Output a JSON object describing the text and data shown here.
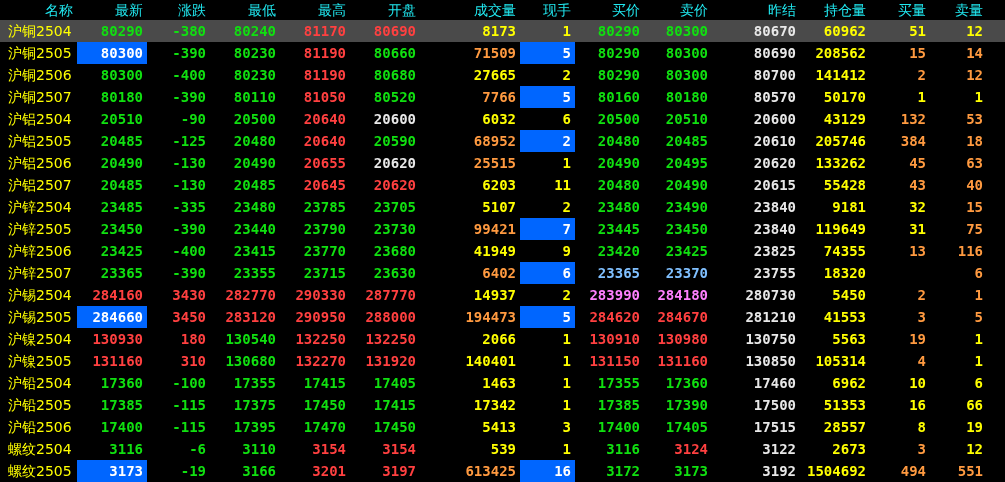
{
  "table": {
    "columns": [
      "名称",
      "最新",
      "涨跌",
      "最低",
      "最高",
      "开盘",
      "成交量",
      "现手",
      "买价",
      "卖价",
      "昨结",
      "持仓量",
      "买量",
      "卖量"
    ],
    "rows": [
      {
        "selected": true,
        "cells": [
          {
            "text": "沪铜2504"
          },
          {
            "text": "80290",
            "color": "#10e010"
          },
          {
            "text": "-380",
            "color": "#10e010"
          },
          {
            "text": "80240",
            "color": "#10e010"
          },
          {
            "text": "81170",
            "color": "#ff4040"
          },
          {
            "text": "80690",
            "color": "#ff4040"
          },
          {
            "text": "8173",
            "color": "#ffff00"
          },
          {
            "text": "1",
            "color": "#ffff00"
          },
          {
            "text": "80290",
            "color": "#10e010"
          },
          {
            "text": "80300",
            "color": "#10e010"
          },
          {
            "text": "80670",
            "color": "#e8e8e8"
          },
          {
            "text": "60962",
            "color": "#ffff00"
          },
          {
            "text": "51",
            "color": "#ffff00"
          },
          {
            "text": "12",
            "color": "#ffff00"
          }
        ]
      },
      {
        "selected": false,
        "cells": [
          {
            "text": "沪铜2505"
          },
          {
            "text": "80300",
            "highlighted": true
          },
          {
            "text": "-390",
            "color": "#10e010"
          },
          {
            "text": "80230",
            "color": "#10e010"
          },
          {
            "text": "81190",
            "color": "#ff4040"
          },
          {
            "text": "80660",
            "color": "#10e010"
          },
          {
            "text": "71509",
            "color": "#ff9a40"
          },
          {
            "text": "5",
            "highlighted": true
          },
          {
            "text": "80290",
            "color": "#10e010"
          },
          {
            "text": "80300",
            "color": "#10e010"
          },
          {
            "text": "80690",
            "color": "#e8e8e8"
          },
          {
            "text": "208562",
            "color": "#ffff00"
          },
          {
            "text": "15",
            "color": "#ff9a40"
          },
          {
            "text": "14",
            "color": "#ff9a40"
          }
        ]
      },
      {
        "selected": false,
        "cells": [
          {
            "text": "沪铜2506"
          },
          {
            "text": "80300",
            "color": "#10e010"
          },
          {
            "text": "-400",
            "color": "#10e010"
          },
          {
            "text": "80230",
            "color": "#10e010"
          },
          {
            "text": "81190",
            "color": "#ff4040"
          },
          {
            "text": "80680",
            "color": "#10e010"
          },
          {
            "text": "27665",
            "color": "#ffff00"
          },
          {
            "text": "2",
            "color": "#ffff00"
          },
          {
            "text": "80290",
            "color": "#10e010"
          },
          {
            "text": "80300",
            "color": "#10e010"
          },
          {
            "text": "80700",
            "color": "#e8e8e8"
          },
          {
            "text": "141412",
            "color": "#ffff00"
          },
          {
            "text": "2",
            "color": "#ff9a40"
          },
          {
            "text": "12",
            "color": "#ff9a40"
          }
        ]
      },
      {
        "selected": false,
        "cells": [
          {
            "text": "沪铜2507"
          },
          {
            "text": "80180",
            "color": "#10e010"
          },
          {
            "text": "-390",
            "color": "#10e010"
          },
          {
            "text": "80110",
            "color": "#10e010"
          },
          {
            "text": "81050",
            "color": "#ff4040"
          },
          {
            "text": "80520",
            "color": "#10e010"
          },
          {
            "text": "7766",
            "color": "#ff9a40"
          },
          {
            "text": "5",
            "highlighted": true
          },
          {
            "text": "80160",
            "color": "#10e010"
          },
          {
            "text": "80180",
            "color": "#10e010"
          },
          {
            "text": "80570",
            "color": "#e8e8e8"
          },
          {
            "text": "50170",
            "color": "#ffff00"
          },
          {
            "text": "1",
            "color": "#ffff00"
          },
          {
            "text": "1",
            "color": "#ffff00"
          }
        ]
      },
      {
        "selected": false,
        "cells": [
          {
            "text": "沪铝2504"
          },
          {
            "text": "20510",
            "color": "#10e010"
          },
          {
            "text": "-90",
            "color": "#10e010"
          },
          {
            "text": "20500",
            "color": "#10e010"
          },
          {
            "text": "20640",
            "color": "#ff4040"
          },
          {
            "text": "20600",
            "color": "#e8e8e8"
          },
          {
            "text": "6032",
            "color": "#ffff00"
          },
          {
            "text": "6",
            "color": "#ffff00"
          },
          {
            "text": "20500",
            "color": "#10e010"
          },
          {
            "text": "20510",
            "color": "#10e010"
          },
          {
            "text": "20600",
            "color": "#e8e8e8"
          },
          {
            "text": "43129",
            "color": "#ffff00"
          },
          {
            "text": "132",
            "color": "#ff9a40"
          },
          {
            "text": "53",
            "color": "#ff9a40"
          }
        ]
      },
      {
        "selected": false,
        "cells": [
          {
            "text": "沪铝2505"
          },
          {
            "text": "20485",
            "color": "#10e010"
          },
          {
            "text": "-125",
            "color": "#10e010"
          },
          {
            "text": "20480",
            "color": "#10e010"
          },
          {
            "text": "20640",
            "color": "#ff4040"
          },
          {
            "text": "20590",
            "color": "#10e010"
          },
          {
            "text": "68952",
            "color": "#ff9a40"
          },
          {
            "text": "2",
            "highlighted": true
          },
          {
            "text": "20480",
            "color": "#10e010"
          },
          {
            "text": "20485",
            "color": "#10e010"
          },
          {
            "text": "20610",
            "color": "#e8e8e8"
          },
          {
            "text": "205746",
            "color": "#ffff00"
          },
          {
            "text": "384",
            "color": "#ff9a40"
          },
          {
            "text": "18",
            "color": "#ff9a40"
          }
        ]
      },
      {
        "selected": false,
        "cells": [
          {
            "text": "沪铝2506"
          },
          {
            "text": "20490",
            "color": "#10e010"
          },
          {
            "text": "-130",
            "color": "#10e010"
          },
          {
            "text": "20490",
            "color": "#10e010"
          },
          {
            "text": "20655",
            "color": "#ff4040"
          },
          {
            "text": "20620",
            "color": "#e8e8e8"
          },
          {
            "text": "25515",
            "color": "#ff9a40"
          },
          {
            "text": "1",
            "color": "#ffff00"
          },
          {
            "text": "20490",
            "color": "#10e010"
          },
          {
            "text": "20495",
            "color": "#10e010"
          },
          {
            "text": "20620",
            "color": "#e8e8e8"
          },
          {
            "text": "133262",
            "color": "#ffff00"
          },
          {
            "text": "45",
            "color": "#ff9a40"
          },
          {
            "text": "63",
            "color": "#ff9a40"
          }
        ]
      },
      {
        "selected": false,
        "cells": [
          {
            "text": "沪铝2507"
          },
          {
            "text": "20485",
            "color": "#10e010"
          },
          {
            "text": "-130",
            "color": "#10e010"
          },
          {
            "text": "20485",
            "color": "#10e010"
          },
          {
            "text": "20645",
            "color": "#ff4040"
          },
          {
            "text": "20620",
            "color": "#ff4040"
          },
          {
            "text": "6203",
            "color": "#ffff00"
          },
          {
            "text": "11",
            "color": "#ffff00"
          },
          {
            "text": "20480",
            "color": "#10e010"
          },
          {
            "text": "20490",
            "color": "#10e010"
          },
          {
            "text": "20615",
            "color": "#e8e8e8"
          },
          {
            "text": "55428",
            "color": "#ffff00"
          },
          {
            "text": "43",
            "color": "#ff9a40"
          },
          {
            "text": "40",
            "color": "#ff9a40"
          }
        ]
      },
      {
        "selected": false,
        "cells": [
          {
            "text": "沪锌2504"
          },
          {
            "text": "23485",
            "color": "#10e010"
          },
          {
            "text": "-335",
            "color": "#10e010"
          },
          {
            "text": "23480",
            "color": "#10e010"
          },
          {
            "text": "23785",
            "color": "#10e010"
          },
          {
            "text": "23705",
            "color": "#10e010"
          },
          {
            "text": "5107",
            "color": "#ffff00"
          },
          {
            "text": "2",
            "color": "#ffff00"
          },
          {
            "text": "23480",
            "color": "#10e010"
          },
          {
            "text": "23490",
            "color": "#10e010"
          },
          {
            "text": "23840",
            "color": "#e8e8e8"
          },
          {
            "text": "9181",
            "color": "#ffff00"
          },
          {
            "text": "32",
            "color": "#ffff00"
          },
          {
            "text": "15",
            "color": "#ff9a40"
          }
        ]
      },
      {
        "selected": false,
        "cells": [
          {
            "text": "沪锌2505"
          },
          {
            "text": "23450",
            "color": "#10e010"
          },
          {
            "text": "-390",
            "color": "#10e010"
          },
          {
            "text": "23440",
            "color": "#10e010"
          },
          {
            "text": "23790",
            "color": "#10e010"
          },
          {
            "text": "23730",
            "color": "#10e010"
          },
          {
            "text": "99421",
            "color": "#ff9a40"
          },
          {
            "text": "7",
            "highlighted": true
          },
          {
            "text": "23445",
            "color": "#10e010"
          },
          {
            "text": "23450",
            "color": "#10e010"
          },
          {
            "text": "23840",
            "color": "#e8e8e8"
          },
          {
            "text": "119649",
            "color": "#ffff00"
          },
          {
            "text": "31",
            "color": "#ffff00"
          },
          {
            "text": "75",
            "color": "#ff9a40"
          }
        ]
      },
      {
        "selected": false,
        "cells": [
          {
            "text": "沪锌2506"
          },
          {
            "text": "23425",
            "color": "#10e010"
          },
          {
            "text": "-400",
            "color": "#10e010"
          },
          {
            "text": "23415",
            "color": "#10e010"
          },
          {
            "text": "23770",
            "color": "#10e010"
          },
          {
            "text": "23680",
            "color": "#10e010"
          },
          {
            "text": "41949",
            "color": "#ffff00"
          },
          {
            "text": "9",
            "color": "#ffff00"
          },
          {
            "text": "23420",
            "color": "#10e010"
          },
          {
            "text": "23425",
            "color": "#10e010"
          },
          {
            "text": "23825",
            "color": "#e8e8e8"
          },
          {
            "text": "74355",
            "color": "#ffff00"
          },
          {
            "text": "13",
            "color": "#ff9a40"
          },
          {
            "text": "116",
            "color": "#ff9a40"
          }
        ]
      },
      {
        "selected": false,
        "cells": [
          {
            "text": "沪锌2507"
          },
          {
            "text": "23365",
            "color": "#10e010"
          },
          {
            "text": "-390",
            "color": "#10e010"
          },
          {
            "text": "23355",
            "color": "#10e010"
          },
          {
            "text": "23715",
            "color": "#10e010"
          },
          {
            "text": "23630",
            "color": "#10e010"
          },
          {
            "text": "6402",
            "color": "#ff9a40"
          },
          {
            "text": "6",
            "highlighted": true
          },
          {
            "text": "23365",
            "color": "#80c0ff"
          },
          {
            "text": "23370",
            "color": "#80c0ff"
          },
          {
            "text": "23755",
            "color": "#e8e8e8"
          },
          {
            "text": "18320",
            "color": "#ffff00"
          },
          null,
          {
            "text": "6",
            "color": "#ff9a40"
          }
        ]
      },
      {
        "selected": false,
        "cells": [
          {
            "text": "沪锡2504"
          },
          {
            "text": "284160",
            "color": "#ff4040"
          },
          {
            "text": "3430",
            "color": "#ff4040"
          },
          {
            "text": "282770",
            "color": "#ff4040"
          },
          {
            "text": "290330",
            "color": "#ff4040"
          },
          {
            "text": "287770",
            "color": "#ff4040"
          },
          {
            "text": "14937",
            "color": "#ffff00"
          },
          {
            "text": "2",
            "color": "#ffff00"
          },
          {
            "text": "283990",
            "color": "#ff80ff"
          },
          {
            "text": "284180",
            "color": "#ff80ff"
          },
          {
            "text": "280730",
            "color": "#e8e8e8"
          },
          {
            "text": "5450",
            "color": "#ffff00"
          },
          {
            "text": "2",
            "color": "#ff9a40"
          },
          {
            "text": "1",
            "color": "#ff9a40"
          }
        ]
      },
      {
        "selected": false,
        "cells": [
          {
            "text": "沪锡2505"
          },
          {
            "text": "284660",
            "highlighted": true
          },
          {
            "text": "3450",
            "color": "#ff4040"
          },
          {
            "text": "283120",
            "color": "#ff4040"
          },
          {
            "text": "290950",
            "color": "#ff4040"
          },
          {
            "text": "288000",
            "color": "#ff4040"
          },
          {
            "text": "194473",
            "color": "#ff9a40"
          },
          {
            "text": "5",
            "highlighted": true
          },
          {
            "text": "284620",
            "color": "#ff4040"
          },
          {
            "text": "284670",
            "color": "#ff4040"
          },
          {
            "text": "281210",
            "color": "#e8e8e8"
          },
          {
            "text": "41553",
            "color": "#ffff00"
          },
          {
            "text": "3",
            "color": "#ff9a40"
          },
          {
            "text": "5",
            "color": "#ff9a40"
          }
        ]
      },
      {
        "selected": false,
        "cells": [
          {
            "text": "沪镍2504"
          },
          {
            "text": "130930",
            "color": "#ff4040"
          },
          {
            "text": "180",
            "color": "#ff4040"
          },
          {
            "text": "130540",
            "color": "#10e010"
          },
          {
            "text": "132250",
            "color": "#ff4040"
          },
          {
            "text": "132250",
            "color": "#ff4040"
          },
          {
            "text": "2066",
            "color": "#ffff00"
          },
          {
            "text": "1",
            "color": "#ffff00"
          },
          {
            "text": "130910",
            "color": "#ff4040"
          },
          {
            "text": "130980",
            "color": "#ff4040"
          },
          {
            "text": "130750",
            "color": "#e8e8e8"
          },
          {
            "text": "5563",
            "color": "#ffff00"
          },
          {
            "text": "19",
            "color": "#ff9a40"
          },
          {
            "text": "1",
            "color": "#ffff00"
          }
        ]
      },
      {
        "selected": false,
        "cells": [
          {
            "text": "沪镍2505"
          },
          {
            "text": "131160",
            "color": "#ff4040"
          },
          {
            "text": "310",
            "color": "#ff4040"
          },
          {
            "text": "130680",
            "color": "#10e010"
          },
          {
            "text": "132270",
            "color": "#ff4040"
          },
          {
            "text": "131920",
            "color": "#ff4040"
          },
          {
            "text": "140401",
            "color": "#ffff00"
          },
          {
            "text": "1",
            "color": "#ffff00"
          },
          {
            "text": "131150",
            "color": "#ff4040"
          },
          {
            "text": "131160",
            "color": "#ff4040"
          },
          {
            "text": "130850",
            "color": "#e8e8e8"
          },
          {
            "text": "105314",
            "color": "#ffff00"
          },
          {
            "text": "4",
            "color": "#ff9a40"
          },
          {
            "text": "1",
            "color": "#ffff00"
          }
        ]
      },
      {
        "selected": false,
        "cells": [
          {
            "text": "沪铅2504"
          },
          {
            "text": "17360",
            "color": "#10e010"
          },
          {
            "text": "-100",
            "color": "#10e010"
          },
          {
            "text": "17355",
            "color": "#10e010"
          },
          {
            "text": "17415",
            "color": "#10e010"
          },
          {
            "text": "17405",
            "color": "#10e010"
          },
          {
            "text": "1463",
            "color": "#ffff00"
          },
          {
            "text": "1",
            "color": "#ffff00"
          },
          {
            "text": "17355",
            "color": "#10e010"
          },
          {
            "text": "17360",
            "color": "#10e010"
          },
          {
            "text": "17460",
            "color": "#e8e8e8"
          },
          {
            "text": "6962",
            "color": "#ffff00"
          },
          {
            "text": "10",
            "color": "#ffff00"
          },
          {
            "text": "6",
            "color": "#ffff00"
          }
        ]
      },
      {
        "selected": false,
        "cells": [
          {
            "text": "沪铅2505"
          },
          {
            "text": "17385",
            "color": "#10e010"
          },
          {
            "text": "-115",
            "color": "#10e010"
          },
          {
            "text": "17375",
            "color": "#10e010"
          },
          {
            "text": "17450",
            "color": "#10e010"
          },
          {
            "text": "17415",
            "color": "#10e010"
          },
          {
            "text": "17342",
            "color": "#ffff00"
          },
          {
            "text": "1",
            "color": "#ffff00"
          },
          {
            "text": "17385",
            "color": "#10e010"
          },
          {
            "text": "17390",
            "color": "#10e010"
          },
          {
            "text": "17500",
            "color": "#e8e8e8"
          },
          {
            "text": "51353",
            "color": "#ffff00"
          },
          {
            "text": "16",
            "color": "#ffff00"
          },
          {
            "text": "66",
            "color": "#ffff00"
          }
        ]
      },
      {
        "selected": false,
        "cells": [
          {
            "text": "沪铅2506"
          },
          {
            "text": "17400",
            "color": "#10e010"
          },
          {
            "text": "-115",
            "color": "#10e010"
          },
          {
            "text": "17395",
            "color": "#10e010"
          },
          {
            "text": "17470",
            "color": "#10e010"
          },
          {
            "text": "17450",
            "color": "#10e010"
          },
          {
            "text": "5413",
            "color": "#ffff00"
          },
          {
            "text": "3",
            "color": "#ffff00"
          },
          {
            "text": "17400",
            "color": "#10e010"
          },
          {
            "text": "17405",
            "color": "#10e010"
          },
          {
            "text": "17515",
            "color": "#e8e8e8"
          },
          {
            "text": "28557",
            "color": "#ffff00"
          },
          {
            "text": "8",
            "color": "#ffff00"
          },
          {
            "text": "19",
            "color": "#ffff00"
          }
        ]
      },
      {
        "selected": false,
        "cells": [
          {
            "text": "螺纹2504"
          },
          {
            "text": "3116",
            "color": "#10e010"
          },
          {
            "text": "-6",
            "color": "#10e010"
          },
          {
            "text": "3110",
            "color": "#10e010"
          },
          {
            "text": "3154",
            "color": "#ff4040"
          },
          {
            "text": "3154",
            "color": "#ff4040"
          },
          {
            "text": "539",
            "color": "#ffff00"
          },
          {
            "text": "1",
            "color": "#ffff00"
          },
          {
            "text": "3116",
            "color": "#10e010"
          },
          {
            "text": "3124",
            "color": "#ff4040"
          },
          {
            "text": "3122",
            "color": "#e8e8e8"
          },
          {
            "text": "2673",
            "color": "#ffff00"
          },
          {
            "text": "3",
            "color": "#ff9a40"
          },
          {
            "text": "12",
            "color": "#ffff00"
          }
        ]
      },
      {
        "selected": false,
        "cells": [
          {
            "text": "螺纹2505"
          },
          {
            "text": "3173",
            "highlighted": true
          },
          {
            "text": "-19",
            "color": "#10e010"
          },
          {
            "text": "3166",
            "color": "#10e010"
          },
          {
            "text": "3201",
            "color": "#ff4040"
          },
          {
            "text": "3197",
            "color": "#ff4040"
          },
          {
            "text": "613425",
            "color": "#ff9a40"
          },
          {
            "text": "16",
            "highlighted": true
          },
          {
            "text": "3172",
            "color": "#10e010"
          },
          {
            "text": "3173",
            "color": "#10e010"
          },
          {
            "text": "3192",
            "color": "#e8e8e8"
          },
          {
            "text": "1504692",
            "color": "#ffff00"
          },
          {
            "text": "494",
            "color": "#ff9a40"
          },
          {
            "text": "551",
            "color": "#ff9a40"
          }
        ]
      }
    ]
  }
}
